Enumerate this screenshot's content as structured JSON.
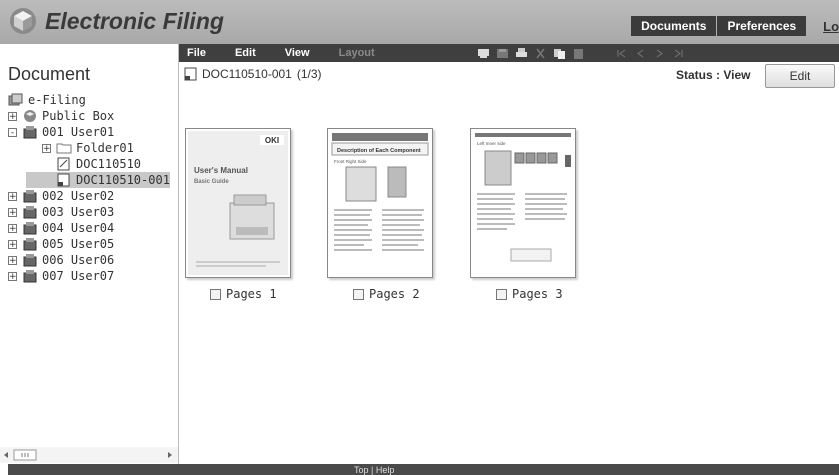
{
  "app": {
    "title": "Electronic Filing",
    "logo_icon": "cube-logo-icon"
  },
  "topnav": {
    "documents": "Documents",
    "preferences": "Preferences",
    "logout": "Log"
  },
  "menu": {
    "file": "File",
    "edit": "Edit",
    "view": "View",
    "layout": "Layout"
  },
  "toolbar_icons": [
    "properties-icon",
    "save-icon",
    "print-icon",
    "cut-icon",
    "copy-icon",
    "paste-icon"
  ],
  "pager_icons": [
    "first-page-icon",
    "prev-page-icon",
    "next-page-icon",
    "last-page-icon"
  ],
  "sidebar": {
    "title": "Document",
    "tree": [
      {
        "label": "e-Filing",
        "icon": "efiling-root-icon",
        "level": 0
      },
      {
        "label": "Public Box",
        "icon": "public-box-icon",
        "level": 1,
        "expander": "+"
      },
      {
        "label": "001 User01",
        "icon": "user-box-icon",
        "level": 1,
        "expander": "-"
      },
      {
        "label": "Folder01",
        "icon": "folder-icon",
        "level": 2,
        "expander": "+"
      },
      {
        "label": "DOC110510",
        "icon": "document-icon",
        "level": 3
      },
      {
        "label": "DOC110510-001",
        "icon": "document-icon",
        "level": 3,
        "selected": true
      },
      {
        "label": "002 User02",
        "icon": "user-box-icon",
        "level": 1,
        "expander": "+"
      },
      {
        "label": "003 User03",
        "icon": "user-box-icon",
        "level": 1,
        "expander": "+"
      },
      {
        "label": "004 User04",
        "icon": "user-box-icon",
        "level": 1,
        "expander": "+"
      },
      {
        "label": "005 User05",
        "icon": "user-box-icon",
        "level": 1,
        "expander": "+"
      },
      {
        "label": "006 User06",
        "icon": "user-box-icon",
        "level": 1,
        "expander": "+"
      },
      {
        "label": "007 User07",
        "icon": "user-box-icon",
        "level": 1,
        "expander": "+"
      }
    ]
  },
  "main": {
    "doc_title": "DOC110510-001",
    "page_info": "(1/3)",
    "status": "Status : View",
    "edit_label": "Edit",
    "pages": [
      {
        "label": "Pages 1",
        "brand": "OKI",
        "heading": "User's Manual",
        "sub": "Basic Guide"
      },
      {
        "label": "Pages 2",
        "heading": "Description of Each Component",
        "sub": "Front Right Side"
      },
      {
        "label": "Pages 3",
        "heading": "Left Inner side"
      }
    ]
  },
  "footer": {
    "text": "Top | Help"
  }
}
